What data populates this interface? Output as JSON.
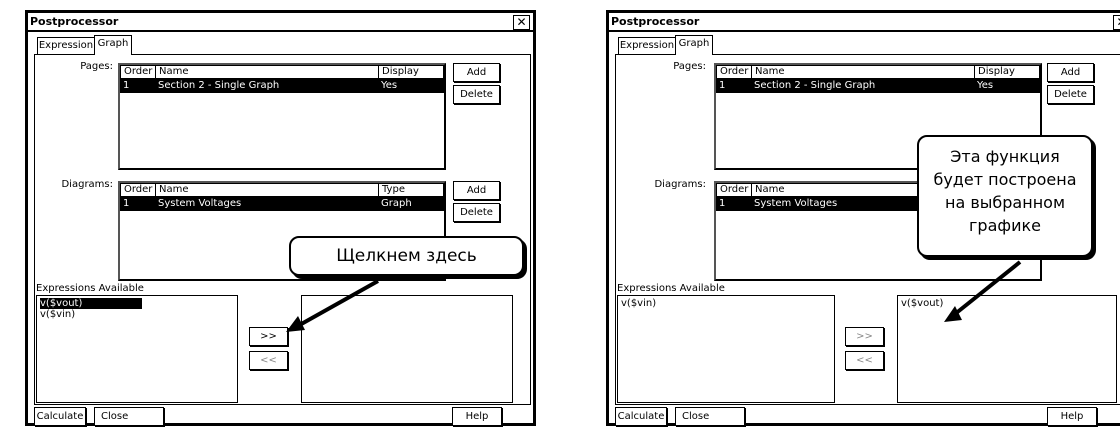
{
  "left": {
    "title": "Postprocessor",
    "close_icon": "close-icon",
    "tabs": [
      "Expression",
      "Graph"
    ],
    "pages_label": "Pages:",
    "pages_headers": [
      "Order",
      "Name",
      "Display"
    ],
    "pages_row": {
      "order": "1",
      "name": "Section 2 - Single Graph",
      "display": "Yes"
    },
    "diagrams_label": "Diagrams:",
    "diagrams_headers": [
      "Order",
      "Name",
      "Type"
    ],
    "diagrams_row": {
      "order": "1",
      "name": "System Voltages",
      "type": "Graph"
    },
    "add_label": "Add",
    "delete_label": "Delete",
    "expressions_label": "Expressions Available",
    "expressions_available": [
      "v($vout)",
      "v($vin)"
    ],
    "expressions_selected": [],
    "move_right": ">>",
    "move_left": "<<",
    "calculate": "Calculate",
    "close": "Close",
    "help": "Help",
    "callout": "Щелкнем здесь"
  },
  "right": {
    "title": "Postprocessor",
    "tabs": [
      "Expression",
      "Graph"
    ],
    "pages_label": "Pages:",
    "pages_headers": [
      "Order",
      "Name",
      "Display"
    ],
    "pages_row": {
      "order": "1",
      "name": "Section 2 - Single Graph",
      "display": "Yes"
    },
    "diagrams_label": "Diagrams:",
    "diagrams_headers": [
      "Order",
      "Name"
    ],
    "diagrams_row": {
      "order": "1",
      "name": "System Voltages"
    },
    "add_label": "Add",
    "delete_label": "Delete",
    "expressions_label": "Expressions Available",
    "expressions_available": [
      "v($vin)"
    ],
    "expressions_selected": [
      "v($vout)"
    ],
    "move_right": ">>",
    "move_left": "<<",
    "calculate": "Calculate",
    "close": "Close",
    "help": "Help",
    "callout": [
      "Эта функция",
      "будет построена",
      "на выбранном",
      "графике"
    ]
  }
}
